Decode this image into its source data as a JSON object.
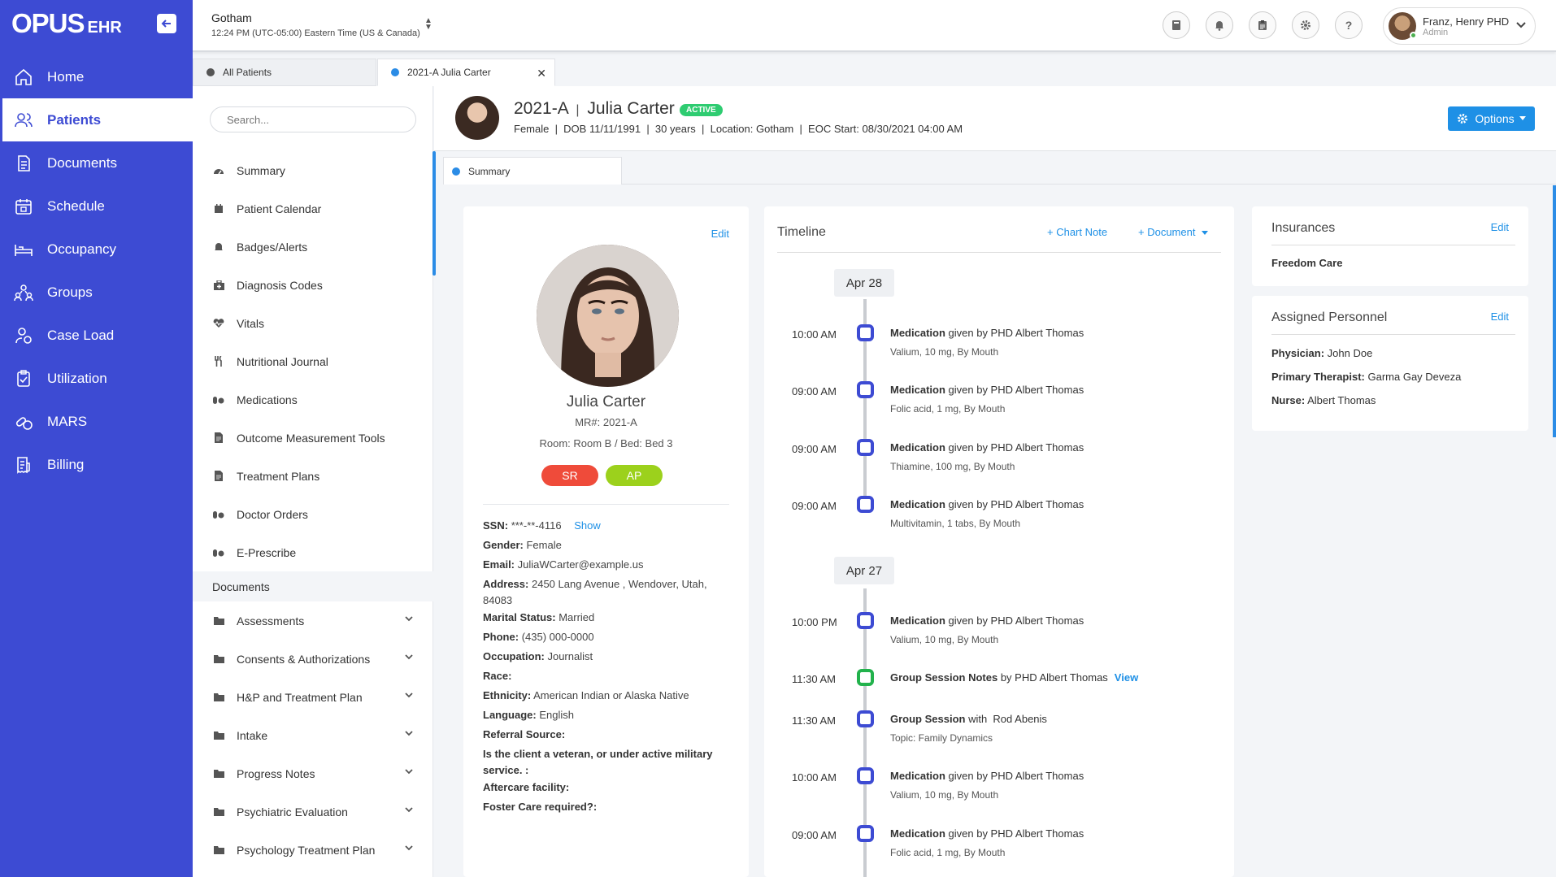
{
  "app": {
    "logo_main": "OPUS",
    "logo_sub": "EHR"
  },
  "nav": [
    {
      "label": "Home",
      "icon": "home-icon"
    },
    {
      "label": "Patients",
      "icon": "patients-icon",
      "active": true
    },
    {
      "label": "Documents",
      "icon": "documents-icon"
    },
    {
      "label": "Schedule",
      "icon": "calendar-icon"
    },
    {
      "label": "Occupancy",
      "icon": "bed-icon"
    },
    {
      "label": "Groups",
      "icon": "groups-icon"
    },
    {
      "label": "Case Load",
      "icon": "caseload-icon"
    },
    {
      "label": "Utilization",
      "icon": "clipboard-check-icon"
    },
    {
      "label": "MARS",
      "icon": "pills-icon"
    },
    {
      "label": "Billing",
      "icon": "receipt-icon"
    }
  ],
  "topbar": {
    "location": "Gotham",
    "timezone": "12:24 PM (UTC-05:00) Eastern Time (US & Canada)",
    "user_name": "Franz, Henry PHD",
    "user_role": "Admin"
  },
  "tabs": {
    "all_patients": "All Patients",
    "current": "2021-A Julia Carter"
  },
  "patient_menu": {
    "search_placeholder": "Search...",
    "items": [
      "Summary",
      "Patient Calendar",
      "Badges/Alerts",
      "Diagnosis Codes",
      "Vitals",
      "Nutritional Journal",
      "Medications",
      "Outcome Measurement Tools",
      "Treatment Plans",
      "Doctor Orders",
      "E-Prescribe"
    ],
    "section": "Documents",
    "folders": [
      "Assessments",
      "Consents & Authorizations",
      "H&P and Treatment Plan",
      "Intake",
      "Progress Notes",
      "Psychiatric Evaluation",
      "Psychology Treatment Plan"
    ]
  },
  "header": {
    "id": "2021-A",
    "sep": "|",
    "name": "Julia Carter",
    "status": "ACTIVE",
    "details": "Female  |  DOB 11/11/1991  |  30 years  |  Location: Gotham  |  EOC Start: 08/30/2021 04:00 AM",
    "options": "Options"
  },
  "summary_tab": "Summary",
  "profile": {
    "edit": "Edit",
    "name": "Julia Carter",
    "mr": "MR#: 2021-A",
    "room": "Room: Room B / Bed: Bed 3",
    "badge_sr": "SR",
    "badge_ap": "AP",
    "ssn_label": "SSN:",
    "ssn_value": "***-**-4116",
    "show": "Show",
    "fields": [
      {
        "label": "Gender:",
        "value": "Female"
      },
      {
        "label": "Email:",
        "value": "JuliaWCarter@example.us"
      },
      {
        "label": "Address:",
        "value": "2450 Lang Avenue , Wendover, Utah, 84083"
      },
      {
        "label": "Marital Status:",
        "value": "Married"
      },
      {
        "label": "Phone:",
        "value": "(435) 000-0000"
      },
      {
        "label": "Occupation:",
        "value": "Journalist"
      },
      {
        "label": "Race:",
        "value": ""
      },
      {
        "label": "Ethnicity:",
        "value": "American Indian or Alaska Native"
      },
      {
        "label": "Language:",
        "value": "English"
      },
      {
        "label": "Referral Source:",
        "value": ""
      },
      {
        "label": "Is the client a veteran, or under active military service. :",
        "value": ""
      },
      {
        "label": "Aftercare facility:",
        "value": ""
      },
      {
        "label": "Foster Care required?:",
        "value": ""
      }
    ]
  },
  "timeline": {
    "title": "Timeline",
    "chart_note": "+ Chart Note",
    "document": "+ Document",
    "date1": "Apr 28",
    "date2": "Apr 27",
    "events": [
      {
        "time": "10:00 AM",
        "title": "Medication",
        "rest": " given by PHD Albert Thomas",
        "sub": "Valium, 10 mg, By Mouth"
      },
      {
        "time": "09:00 AM",
        "title": "Medication",
        "rest": " given by PHD Albert Thomas",
        "sub": "Folic acid, 1 mg, By Mouth"
      },
      {
        "time": "09:00 AM",
        "title": "Medication",
        "rest": " given by PHD Albert Thomas",
        "sub": "Thiamine, 100 mg, By Mouth"
      },
      {
        "time": "09:00 AM",
        "title": "Medication",
        "rest": " given by PHD Albert Thomas",
        "sub": "Multivitamin, 1 tabs, By Mouth"
      },
      {
        "time": "10:00 PM",
        "title": "Medication",
        "rest": " given by PHD Albert Thomas",
        "sub": "Valium, 10 mg, By Mouth"
      },
      {
        "time": "11:30 AM",
        "title": "Group Session Notes",
        "rest": " by PHD Albert Thomas",
        "sub": "",
        "view": "View"
      },
      {
        "time": "11:30 AM",
        "title": "Group Session",
        "rest": " with  Rod Abenis",
        "sub": "Topic: Family Dynamics"
      },
      {
        "time": "10:00 AM",
        "title": "Medication",
        "rest": " given by PHD Albert Thomas",
        "sub": "Valium, 10 mg, By Mouth"
      },
      {
        "time": "09:00 AM",
        "title": "Medication",
        "rest": " given by PHD Albert Thomas",
        "sub": "Folic acid, 1 mg, By Mouth"
      }
    ]
  },
  "insurances": {
    "title": "Insurances",
    "edit": "Edit",
    "value": "Freedom Care"
  },
  "personnel": {
    "title": "Assigned Personnel",
    "edit": "Edit",
    "physician_label": "Physician:",
    "physician": "John Doe",
    "therapist_label": "Primary Therapist:",
    "therapist": "Garma Gay Deveza",
    "nurse_label": "Nurse:",
    "nurse": "Albert Thomas"
  }
}
